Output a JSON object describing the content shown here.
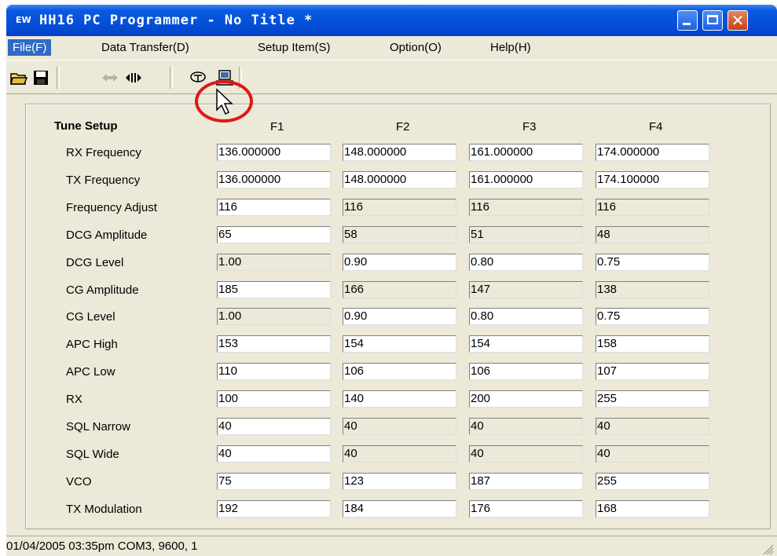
{
  "window": {
    "title": "HH16 PC Programmer - No Title *",
    "app_icon": "EW"
  },
  "menu": [
    {
      "label": "File(F)",
      "active": true
    },
    {
      "label": "Data Transfer(D)"
    },
    {
      "label": "Setup Item(S)"
    },
    {
      "label": "Option(O)"
    },
    {
      "label": "Help(H)"
    }
  ],
  "toolbar": {
    "icons": [
      "open-folder-icon",
      "save-disk-icon",
      "read-arrow-icon",
      "write-arrow-icon",
      "radio-transfer-icon",
      "computer-transfer-icon"
    ]
  },
  "tune": {
    "section_title": "Tune Setup",
    "columns": [
      "F1",
      "F2",
      "F3",
      "F4"
    ],
    "rows": [
      {
        "label": "RX Frequency",
        "values": [
          "136.000000",
          "148.000000",
          "161.000000",
          "174.000000"
        ],
        "editable": [
          true,
          true,
          true,
          true
        ]
      },
      {
        "label": "TX Frequency",
        "values": [
          "136.000000",
          "148.000000",
          "161.000000",
          "174.100000"
        ],
        "editable": [
          true,
          true,
          true,
          true
        ]
      },
      {
        "label": "Frequency Adjust",
        "values": [
          "116",
          "116",
          "116",
          "116"
        ],
        "editable": [
          true,
          false,
          false,
          false
        ]
      },
      {
        "label": "DCG Amplitude",
        "values": [
          "65",
          "58",
          "51",
          "48"
        ],
        "editable": [
          true,
          false,
          false,
          false
        ]
      },
      {
        "label": "DCG Level",
        "values": [
          "1.00",
          "0.90",
          "0.80",
          "0.75"
        ],
        "editable": [
          false,
          true,
          true,
          true
        ]
      },
      {
        "label": "CG Amplitude",
        "values": [
          "185",
          "166",
          "147",
          "138"
        ],
        "editable": [
          true,
          false,
          false,
          false
        ]
      },
      {
        "label": "CG Level",
        "values": [
          "1.00",
          "0.90",
          "0.80",
          "0.75"
        ],
        "editable": [
          false,
          true,
          true,
          true
        ]
      },
      {
        "label": "APC High",
        "values": [
          "153",
          "154",
          "154",
          "158"
        ],
        "editable": [
          true,
          true,
          true,
          true
        ]
      },
      {
        "label": "APC Low",
        "values": [
          "110",
          "106",
          "106",
          "107"
        ],
        "editable": [
          true,
          true,
          true,
          true
        ]
      },
      {
        "label": "RX",
        "values": [
          "100",
          "140",
          "200",
          "255"
        ],
        "editable": [
          true,
          true,
          true,
          true
        ]
      },
      {
        "label": "SQL Narrow",
        "values": [
          "40",
          "40",
          "40",
          "40"
        ],
        "editable": [
          true,
          false,
          false,
          false
        ]
      },
      {
        "label": "SQL Wide",
        "values": [
          "40",
          "40",
          "40",
          "40"
        ],
        "editable": [
          true,
          false,
          false,
          false
        ]
      },
      {
        "label": "VCO",
        "values": [
          "75",
          "123",
          "187",
          "255"
        ],
        "editable": [
          true,
          true,
          true,
          true
        ]
      },
      {
        "label": "TX Modulation",
        "values": [
          "192",
          "184",
          "176",
          "168"
        ],
        "editable": [
          true,
          true,
          true,
          true
        ]
      }
    ]
  },
  "status": {
    "text": "01/04/2005 03:35pm COM3, 9600, 1"
  },
  "colors": {
    "title_blue": "#0450d8",
    "annotation_red": "#e01818",
    "menu_highlight": "#316ac5"
  }
}
